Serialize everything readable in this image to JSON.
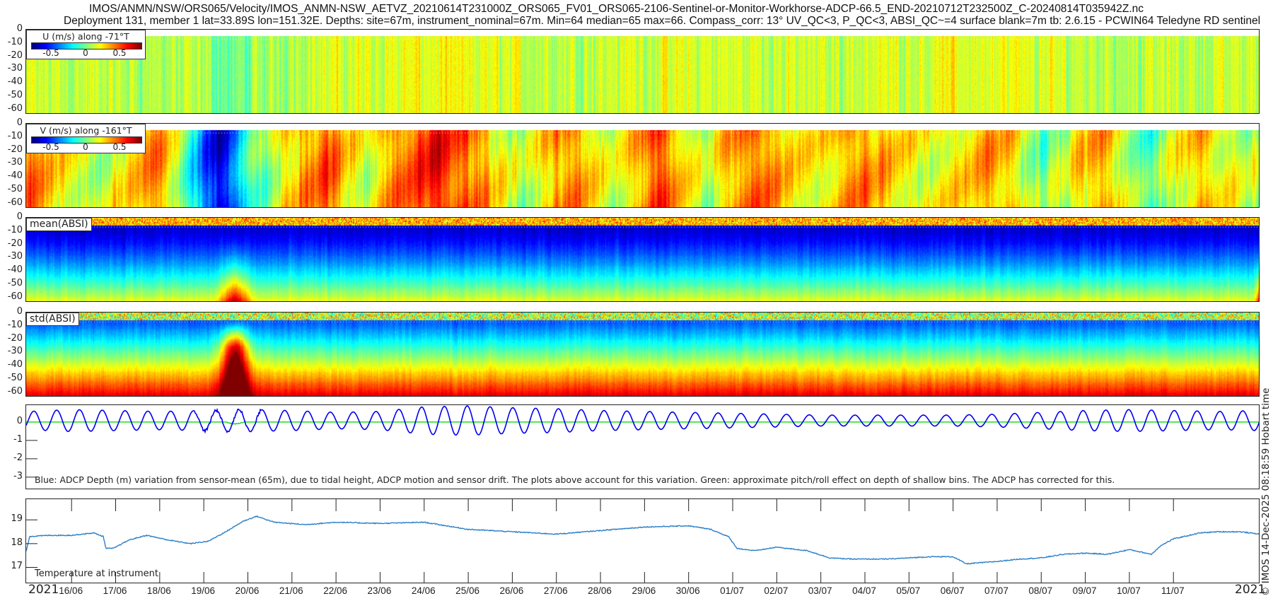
{
  "header": {
    "title_line1": "IMOS/ANMN/NSW/ORS065/Velocity/IMOS_ANMN-NSW_AETVZ_20210614T231000Z_ORS065_FV01_ORS065-2106-Sentinel-or-Monitor-Workhorse-ADCP-66.5_END-20210712T232500Z_C-20240814T035942Z.nc",
    "title_line2": "Deployment 131, member 1 lat=33.89S lon=151.32E. Depths: site=67m, instrument_nominal=67m. Min=64 median=65 max=66. Compass_corr: 13° UV_QC<3, P_QC<3, ABSI_QC~=4 surface blank=7m tb: 2.6.15 - PCWIN64 Teledyne RD sentinel"
  },
  "side_text": "© IMOS 14-Dec-2025 08:18:59 Hobart time",
  "x_axis": {
    "year_left": "2021",
    "year_right": "2021",
    "tick_labels": [
      "16/06",
      "17/06",
      "18/06",
      "19/06",
      "20/06",
      "21/06",
      "22/06",
      "23/06",
      "24/06",
      "25/06",
      "26/06",
      "27/06",
      "28/06",
      "29/06",
      "30/06",
      "01/07",
      "02/07",
      "03/07",
      "04/07",
      "05/07",
      "06/07",
      "07/07",
      "08/07",
      "09/07",
      "10/07",
      "11/07"
    ],
    "range_days_from_16_06": [
      -1.03,
      26.97
    ]
  },
  "colors": {
    "depth_line": "#0000ee",
    "pitch_roll_line": "#22dd22",
    "temperature_line": "#2a7fc8"
  },
  "chart_data": [
    {
      "type": "heatmap",
      "name": "U",
      "legend_title": "U (m/s) along -71°T",
      "colorbar_ticks": [
        "-0.5",
        "0",
        "0.5"
      ],
      "clim": [
        -0.7,
        0.7
      ],
      "ylabel_ticks": [
        "0",
        "-10",
        "-20",
        "-30",
        "-40",
        "-50",
        "-60"
      ],
      "ylim": [
        -64,
        0
      ],
      "surface_blank_m": 7,
      "knots_day_value": [
        [
          -1,
          0.1
        ],
        [
          1,
          0.08
        ],
        [
          3,
          0.05
        ],
        [
          3.6,
          -0.05
        ],
        [
          5,
          0.1
        ],
        [
          8,
          0.15
        ],
        [
          11,
          0.1
        ],
        [
          13,
          0.12
        ],
        [
          17,
          0.1
        ],
        [
          20,
          0.15
        ],
        [
          24,
          0.08
        ],
        [
          27,
          0.1
        ]
      ]
    },
    {
      "type": "heatmap",
      "name": "V",
      "legend_title": "V (m/s) along -161°T",
      "colorbar_ticks": [
        "-0.5",
        "0",
        "0.5"
      ],
      "clim": [
        -0.7,
        0.7
      ],
      "ylabel_ticks": [
        "0",
        "-10",
        "-20",
        "-30",
        "-40",
        "-50",
        "-60"
      ],
      "ylim": [
        -64,
        0
      ],
      "knots_day_value": [
        [
          -1,
          0.4
        ],
        [
          -0.3,
          0.2
        ],
        [
          0.4,
          0.1
        ],
        [
          1.2,
          0.15
        ],
        [
          2,
          0.35
        ],
        [
          2.8,
          -0.2
        ],
        [
          3.4,
          -0.65
        ],
        [
          3.9,
          -0.15
        ],
        [
          4.7,
          0.15
        ],
        [
          5.8,
          0.45
        ],
        [
          6.7,
          0.05
        ],
        [
          7.2,
          0.3
        ],
        [
          8.2,
          0.5
        ],
        [
          9.2,
          0.35
        ],
        [
          10.2,
          0.05
        ],
        [
          11.3,
          0.35
        ],
        [
          12.3,
          0.1
        ],
        [
          13.3,
          0.45
        ],
        [
          14.3,
          0.05
        ],
        [
          15.4,
          0.4
        ],
        [
          16.6,
          0.15
        ],
        [
          17.9,
          0.35
        ],
        [
          19.4,
          0.15
        ],
        [
          21,
          0.3
        ],
        [
          22.1,
          0.0
        ],
        [
          23.3,
          0.3
        ],
        [
          24.5,
          -0.1
        ],
        [
          25.5,
          0.3
        ],
        [
          26.6,
          0.05
        ],
        [
          27,
          0.1
        ]
      ]
    },
    {
      "type": "heatmap",
      "name": "mean(ABSI)",
      "label": "mean(ABSI)",
      "ylabel_ticks": [
        "0",
        "-10",
        "-20",
        "-30",
        "-40",
        "-50",
        "-60"
      ],
      "ylim": [
        -64,
        0
      ],
      "events_day": [
        3.7,
        26.9
      ]
    },
    {
      "type": "heatmap",
      "name": "std(ABSI)",
      "label": "std(ABSI)",
      "ylabel_ticks": [
        "0",
        "-10",
        "-20",
        "-30",
        "-40",
        "-50",
        "-60"
      ],
      "ylim": [
        -64,
        0
      ],
      "events_day": [
        3.7,
        26.9
      ]
    },
    {
      "type": "line",
      "name": "ADCP depth variation",
      "ylabel_ticks": [
        "0",
        "-1",
        "-2",
        "-3"
      ],
      "ylim": [
        -3.7,
        0.92
      ],
      "tidal_period_days": 0.5175,
      "amplitude_knots_day_m": [
        [
          -1,
          0.5
        ],
        [
          0,
          0.6
        ],
        [
          1,
          0.55
        ],
        [
          2,
          0.5
        ],
        [
          3,
          0.55
        ],
        [
          4,
          0.6
        ],
        [
          5,
          0.55
        ],
        [
          6,
          0.45
        ],
        [
          7,
          0.5
        ],
        [
          8,
          0.75
        ],
        [
          9,
          0.8
        ],
        [
          10,
          0.7
        ],
        [
          11,
          0.65
        ],
        [
          12,
          0.55
        ],
        [
          13,
          0.5
        ],
        [
          14,
          0.45
        ],
        [
          15,
          0.4
        ],
        [
          16,
          0.35
        ],
        [
          17,
          0.3
        ],
        [
          18,
          0.3
        ],
        [
          19,
          0.3
        ],
        [
          20,
          0.3
        ],
        [
          21,
          0.35
        ],
        [
          22,
          0.45
        ],
        [
          23,
          0.55
        ],
        [
          24,
          0.6
        ],
        [
          25,
          0.55
        ],
        [
          26,
          0.5
        ],
        [
          27,
          0.55
        ]
      ],
      "note": "Blue: ADCP Depth (m) variation from sensor-mean (65m), due to tidal height, ADCP motion and sensor drift. The plots above account for this variation. Green: approximate pitch/roll effect on depth of shallow bins. The ADCP has corrected for this."
    },
    {
      "type": "line",
      "name": "Temperature at instrument",
      "label": "Temperature at instrument",
      "ylabel_ticks": [
        "19",
        "18",
        "17"
      ],
      "ylim": [
        16.3,
        19.87
      ],
      "points_day_degC": [
        [
          -1.03,
          17.7
        ],
        [
          -0.95,
          18.3
        ],
        [
          -0.5,
          18.35
        ],
        [
          0,
          18.35
        ],
        [
          0.5,
          18.45
        ],
        [
          0.72,
          18.3
        ],
        [
          0.78,
          17.8
        ],
        [
          0.95,
          17.8
        ],
        [
          1.3,
          18.15
        ],
        [
          1.7,
          18.35
        ],
        [
          2.2,
          18.15
        ],
        [
          2.7,
          18.0
        ],
        [
          3.1,
          18.1
        ],
        [
          3.5,
          18.5
        ],
        [
          3.9,
          18.95
        ],
        [
          4.2,
          19.15
        ],
        [
          4.6,
          18.9
        ],
        [
          5.3,
          18.8
        ],
        [
          6,
          18.9
        ],
        [
          7,
          18.85
        ],
        [
          8,
          18.9
        ],
        [
          8.5,
          18.75
        ],
        [
          9,
          18.6
        ],
        [
          10,
          18.5
        ],
        [
          11,
          18.4
        ],
        [
          12,
          18.55
        ],
        [
          13,
          18.7
        ],
        [
          14,
          18.75
        ],
        [
          14.5,
          18.6
        ],
        [
          14.9,
          18.3
        ],
        [
          15.1,
          17.8
        ],
        [
          15.5,
          17.7
        ],
        [
          16,
          17.85
        ],
        [
          16.7,
          17.7
        ],
        [
          17.2,
          17.4
        ],
        [
          17.7,
          17.35
        ],
        [
          18.5,
          17.35
        ],
        [
          19.5,
          17.45
        ],
        [
          20,
          17.45
        ],
        [
          20.3,
          17.15
        ],
        [
          21,
          17.25
        ],
        [
          21.5,
          17.35
        ],
        [
          22,
          17.4
        ],
        [
          22.5,
          17.55
        ],
        [
          23,
          17.6
        ],
        [
          23.5,
          17.55
        ],
        [
          24,
          17.75
        ],
        [
          24.5,
          17.55
        ],
        [
          24.7,
          17.9
        ],
        [
          25,
          18.2
        ],
        [
          25.6,
          18.45
        ],
        [
          26,
          18.5
        ],
        [
          26.5,
          18.5
        ],
        [
          26.97,
          18.4
        ]
      ]
    }
  ]
}
